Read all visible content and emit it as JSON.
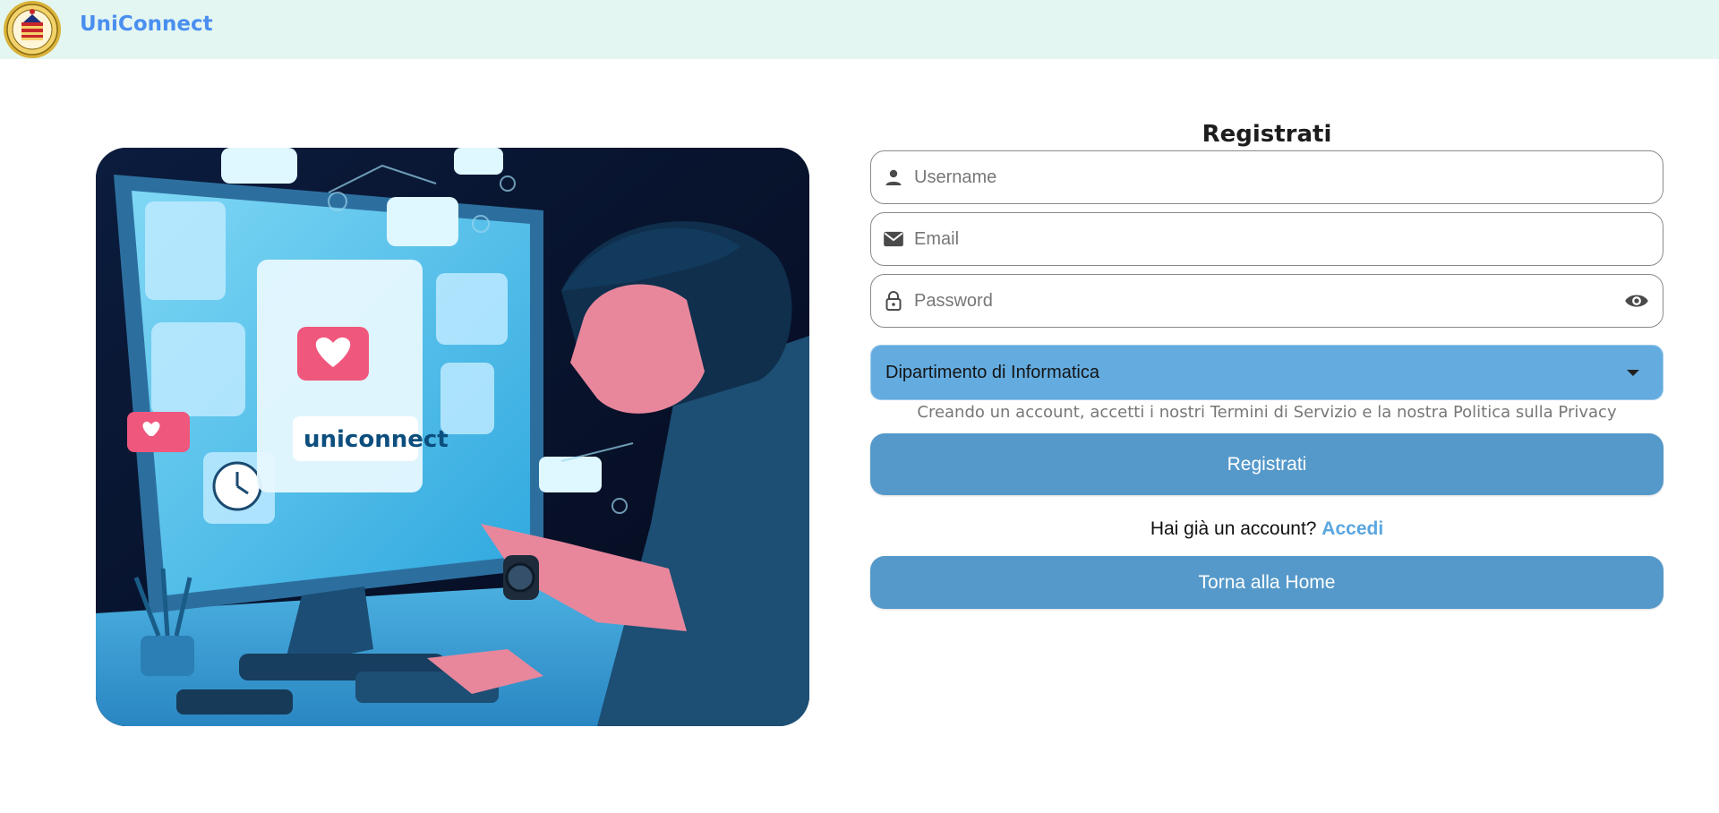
{
  "header": {
    "brand": "UniConnect",
    "logo_icon": "university-seal"
  },
  "hero": {
    "image_icon": "uniconnect-illustration",
    "screen_brand": "uniconnect"
  },
  "form": {
    "title": "Registrati",
    "username": {
      "placeholder": "Username",
      "icon": "person-icon"
    },
    "email": {
      "placeholder": "Email",
      "icon": "mail-icon"
    },
    "password": {
      "placeholder": "Password",
      "icon": "lock-icon",
      "toggle_icon": "eye-icon"
    },
    "department": {
      "selected": "Dipartimento di Informatica"
    },
    "terms": "Creando un account, accetti i nostri Termini di Servizio e la nostra Politica sulla Privacy",
    "register_button": "Registrati",
    "have_account": "Hai già un account?",
    "login_link": "Accedi",
    "home_button": "Torna alla Home"
  },
  "colors": {
    "header_bg": "#e4f6f1",
    "brand": "#4a8ff0",
    "select_bg": "#64ace0",
    "button_bg": "#5599ca",
    "link": "#5aa6df"
  }
}
